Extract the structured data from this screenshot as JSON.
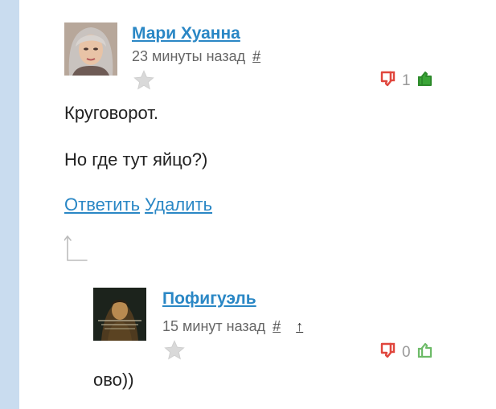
{
  "comment1": {
    "author": "Мари Хуанна",
    "time": "23 минуты назад",
    "anchor": "#",
    "vote_count": "1",
    "paragraphs": [
      "Круговорот.",
      "Но где тут яйцо?)"
    ],
    "reply_label": "Ответить",
    "delete_label": "Удалить"
  },
  "comment2": {
    "author": "Пофигуэль",
    "time": "15 минут назад",
    "anchor": "#",
    "parent_arrow": "↑",
    "vote_count": "0",
    "text": "ово))"
  },
  "icons": {
    "star": "star-icon",
    "dislike": "thumb-down-icon",
    "like": "thumb-up-icon",
    "go-to-parent": "up-arrow-icon"
  },
  "colors": {
    "link": "#2a87c5",
    "dislike": "#e0463d",
    "like_active": "#3aa537",
    "like_inactive": "#6dbb68",
    "sidebar": "#c9dcef"
  }
}
